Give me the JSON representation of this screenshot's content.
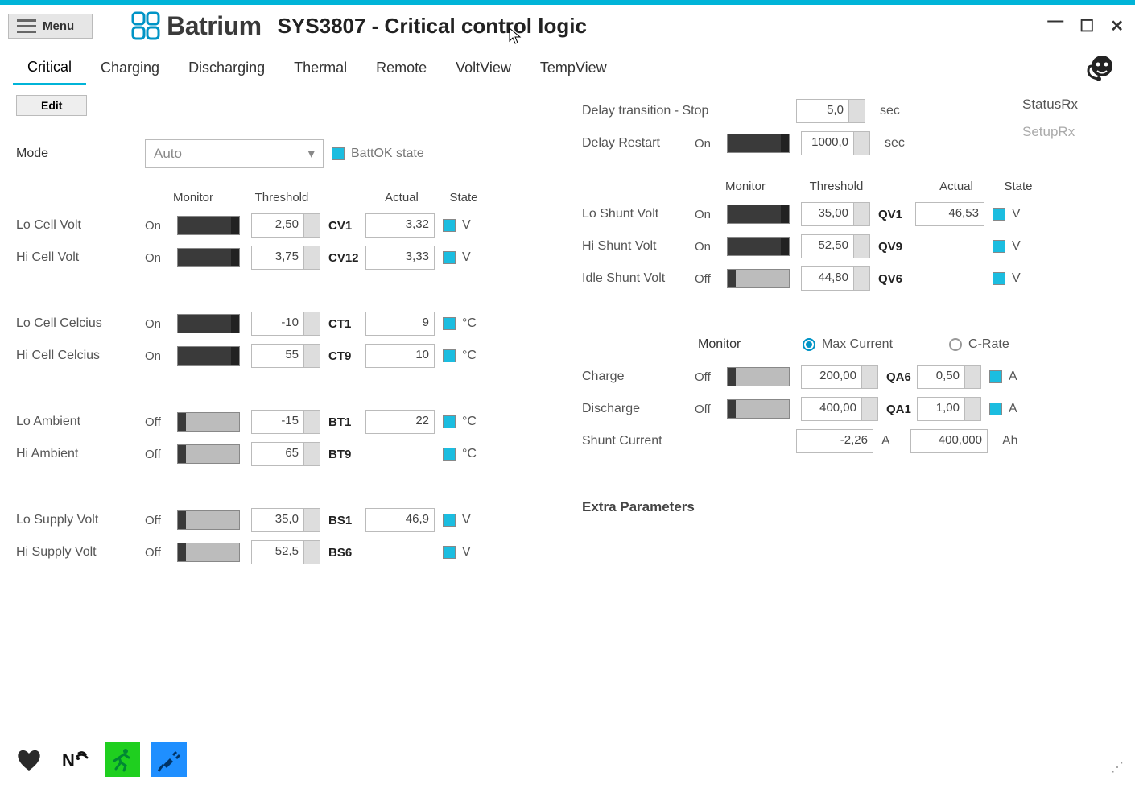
{
  "header": {
    "menu_label": "Menu",
    "brand": "Batrium",
    "title": "SYS3807 - Critical control logic"
  },
  "tabs": [
    "Critical",
    "Charging",
    "Discharging",
    "Thermal",
    "Remote",
    "VoltView",
    "TempView"
  ],
  "active_tab": 0,
  "edit_label": "Edit",
  "mode": {
    "label": "Mode",
    "value": "Auto",
    "battok_label": "BattOK state"
  },
  "headers": {
    "monitor": "Monitor",
    "threshold": "Threshold",
    "actual": "Actual",
    "state": "State"
  },
  "left_rows": [
    {
      "label": "Lo Cell Volt",
      "mon": "On",
      "threshold": "2,50",
      "code": "CV1",
      "actual": "3,32",
      "unit": "V"
    },
    {
      "label": "Hi Cell Volt",
      "mon": "On",
      "threshold": "3,75",
      "code": "CV12",
      "actual": "3,33",
      "unit": "V"
    },
    {
      "gap": true
    },
    {
      "label": "Lo Cell Celcius",
      "mon": "On",
      "threshold": "-10",
      "code": "CT1",
      "actual": "9",
      "unit": "°C"
    },
    {
      "label": "Hi Cell Celcius",
      "mon": "On",
      "threshold": "55",
      "code": "CT9",
      "actual": "10",
      "unit": "°C"
    },
    {
      "gap": true
    },
    {
      "label": "Lo Ambient",
      "mon": "Off",
      "threshold": "-15",
      "code": "BT1",
      "actual": "22",
      "unit": "°C"
    },
    {
      "label": "Hi Ambient",
      "mon": "Off",
      "threshold": "65",
      "code": "BT9",
      "actual": "",
      "unit": "°C"
    },
    {
      "gap": true
    },
    {
      "label": "Lo Supply Volt",
      "mon": "Off",
      "threshold": "35,0",
      "code": "BS1",
      "actual": "46,9",
      "unit": "V"
    },
    {
      "label": "Hi Supply Volt",
      "mon": "Off",
      "threshold": "52,5",
      "code": "BS6",
      "actual": "",
      "unit": "V"
    }
  ],
  "right_top": {
    "delay_stop": {
      "label": "Delay transition - Stop",
      "value": "5,0",
      "unit": "sec"
    },
    "delay_restart": {
      "label": "Delay Restart",
      "mon": "On",
      "value": "1000,0",
      "unit": "sec"
    }
  },
  "status": {
    "rx": "StatusRx",
    "setup": "SetupRx"
  },
  "shunt_rows": [
    {
      "label": "Lo Shunt Volt",
      "mon": "On",
      "threshold": "35,00",
      "code": "QV1",
      "actual": "46,53",
      "unit": "V"
    },
    {
      "label": "Hi Shunt Volt",
      "mon": "On",
      "threshold": "52,50",
      "code": "QV9",
      "actual": "",
      "unit": "V"
    },
    {
      "label": "Idle Shunt Volt",
      "mon": "Off",
      "threshold": "44,80",
      "code": "QV6",
      "actual": "",
      "unit": "V"
    }
  ],
  "rate_radio": {
    "monitor": "Monitor",
    "max_current": "Max Current",
    "c_rate": "C-Rate",
    "selected": "max_current"
  },
  "charge_rows": [
    {
      "label": "Charge",
      "mon": "Off",
      "threshold": "200,00",
      "code": "QA6",
      "actual": "0,50",
      "unit": "A"
    },
    {
      "label": "Discharge",
      "mon": "Off",
      "threshold": "400,00",
      "code": "QA1",
      "actual": "1,00",
      "unit": "A"
    }
  ],
  "shunt_current": {
    "label": "Shunt Current",
    "value": "-2,26",
    "unit": "A",
    "capacity": "400,000",
    "cap_unit": "Ah"
  },
  "extra_label": "Extra Parameters"
}
